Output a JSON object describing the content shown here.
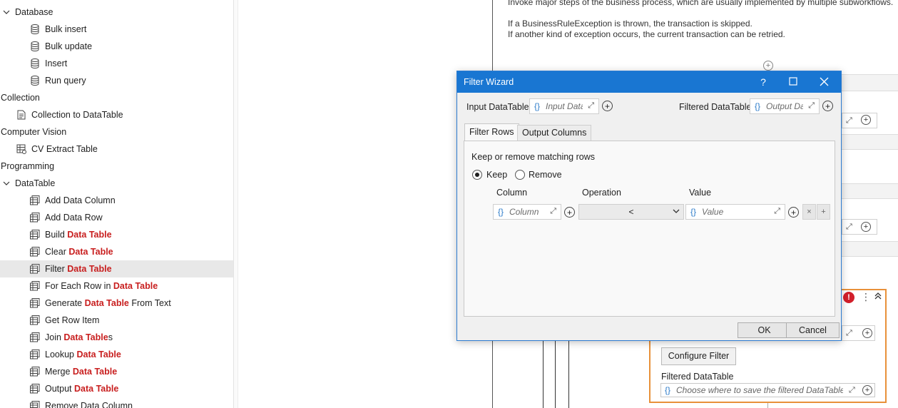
{
  "sidebar": {
    "items": [
      {
        "type": "group",
        "label": "Database",
        "expanded": true
      },
      {
        "type": "activity",
        "label": "Bulk insert",
        "icon": "database-icon"
      },
      {
        "type": "activity",
        "label": "Bulk update",
        "icon": "database-icon"
      },
      {
        "type": "activity",
        "label": "Insert",
        "icon": "database-icon"
      },
      {
        "type": "activity",
        "label": "Run query",
        "icon": "database-icon"
      },
      {
        "type": "category",
        "label": "Collection"
      },
      {
        "type": "activity",
        "label": "Collection to DataTable",
        "icon": "collection-icon"
      },
      {
        "type": "category",
        "label": "Computer Vision"
      },
      {
        "type": "activity",
        "label": "CV Extract Table",
        "icon": "cv-table-icon"
      },
      {
        "type": "category",
        "label": "Programming"
      },
      {
        "type": "group",
        "label": "DataTable",
        "expanded": true
      },
      {
        "type": "activity",
        "pre": "Add Data Column",
        "hl": "",
        "post": "",
        "icon": "datatable-icon"
      },
      {
        "type": "activity",
        "pre": "Add Data Row",
        "hl": "",
        "post": "",
        "icon": "datatable-icon"
      },
      {
        "type": "activity",
        "pre": "Build ",
        "hl": "Data Table",
        "post": "",
        "icon": "datatable-icon"
      },
      {
        "type": "activity",
        "pre": "Clear ",
        "hl": "Data Table",
        "post": "",
        "icon": "datatable-icon"
      },
      {
        "type": "activity",
        "pre": "Filter ",
        "hl": "Data Table",
        "post": "",
        "icon": "datatable-icon",
        "selected": true
      },
      {
        "type": "activity",
        "pre": "For Each Row in ",
        "hl": "Data Table",
        "post": "",
        "icon": "datatable-icon"
      },
      {
        "type": "activity",
        "pre": "Generate ",
        "hl": "Data Table",
        "post": " From Text",
        "icon": "datatable-icon"
      },
      {
        "type": "activity",
        "pre": "Get Row Item",
        "hl": "",
        "post": "",
        "icon": "datatable-icon"
      },
      {
        "type": "activity",
        "pre": "Join ",
        "hl": "Data Table",
        "post": "s",
        "icon": "datatable-icon"
      },
      {
        "type": "activity",
        "pre": "Lookup ",
        "hl": "Data Table",
        "post": "",
        "icon": "datatable-icon"
      },
      {
        "type": "activity",
        "pre": "Merge ",
        "hl": "Data Table",
        "post": "",
        "icon": "datatable-icon"
      },
      {
        "type": "activity",
        "pre": "Output ",
        "hl": "Data Table",
        "post": "",
        "icon": "datatable-icon"
      },
      {
        "type": "activity",
        "pre": "Remove Data Column",
        "hl": "",
        "post": "",
        "icon": "datatable-icon"
      }
    ]
  },
  "canvas": {
    "description_lines": [
      "Invoke major steps of the business process, which are usually implemented by multiple subworkflows.",
      "If a BusinessRuleException is thrown, the transaction is skipped.",
      "If another kind of exception occurs, the current transaction can be retried."
    ],
    "card": {
      "configure_label": "Configure Filter",
      "output_label": "Filtered DataTable",
      "output_placeholder": "Choose where to save the filtered DataTable"
    }
  },
  "dialog": {
    "title": "Filter Wizard",
    "input_label": "Input DataTable",
    "input_placeholder": "Input DataTable",
    "output_label": "Filtered DataTable",
    "output_placeholder": "Output DataTable",
    "tabs": [
      {
        "label": "Filter Rows",
        "active": true
      },
      {
        "label": "Output Columns",
        "active": false
      }
    ],
    "instruction": "Keep or remove matching rows",
    "mode_options": [
      "Keep",
      "Remove"
    ],
    "selected_mode": "Keep",
    "columns": {
      "column": "Column",
      "operation": "Operation",
      "value": "Value"
    },
    "row": {
      "column_placeholder": "Column",
      "operation": "<",
      "value_placeholder": "Value"
    },
    "ok_label": "OK",
    "cancel_label": "Cancel"
  },
  "colors": {
    "accent": "#1976d2",
    "highlight": "#c81e1e",
    "card_border": "#e8913a",
    "error": "#d21f2b"
  }
}
